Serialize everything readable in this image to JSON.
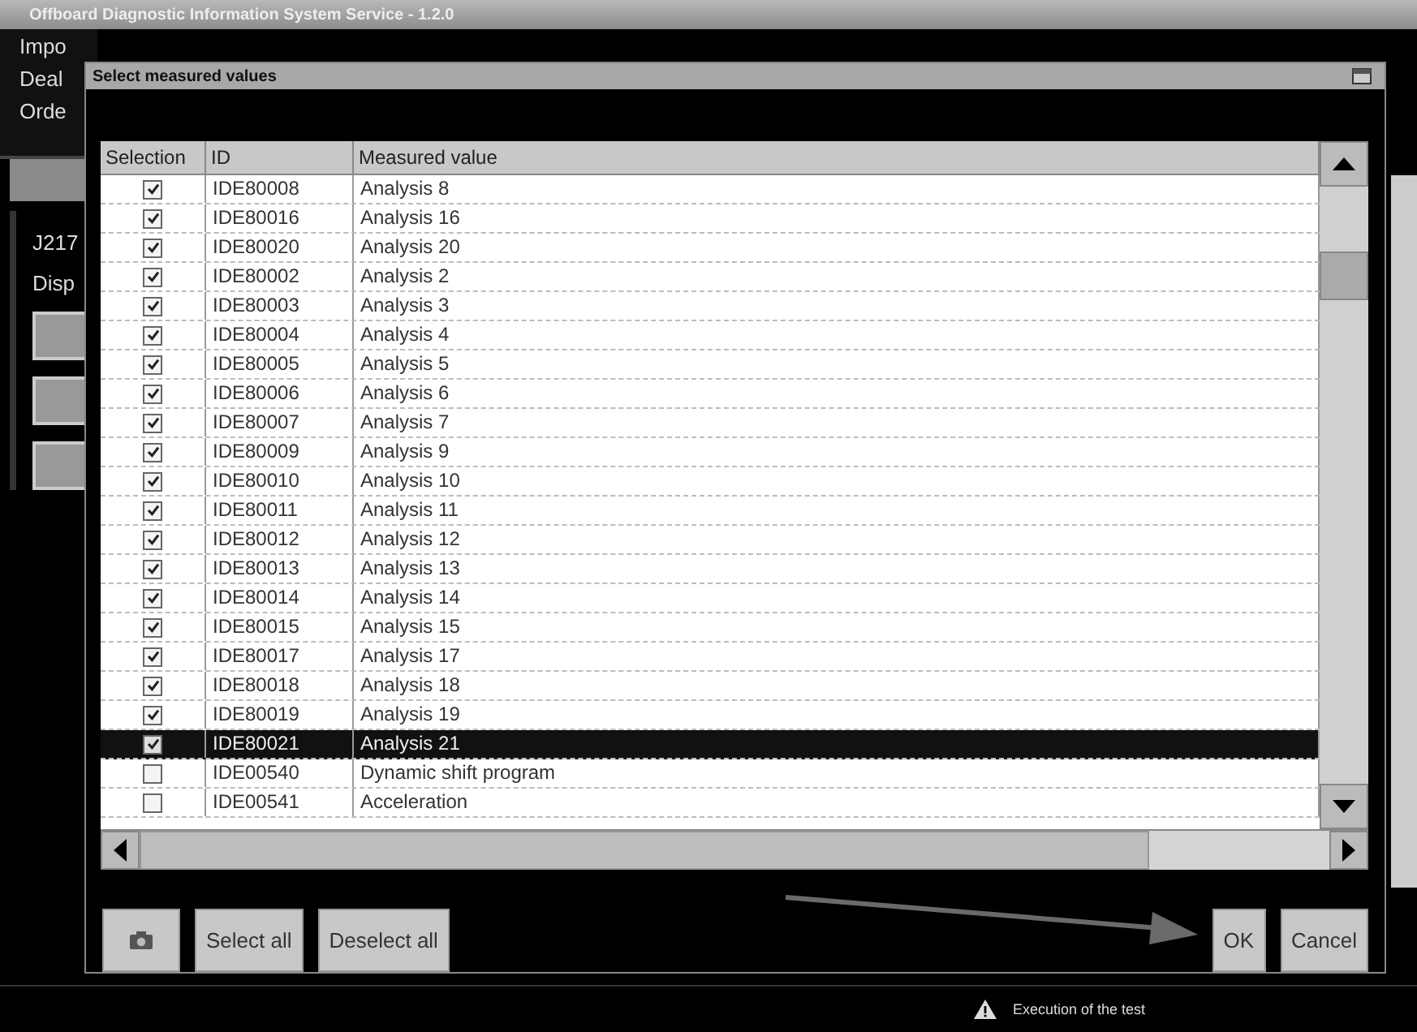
{
  "window": {
    "title": "Offboard Diagnostic Information System Service - 1.2.0"
  },
  "background": {
    "header_labels": [
      "Impo",
      "Deal",
      "Orde"
    ],
    "panel_labels": [
      "J217",
      "Disp"
    ]
  },
  "dialog": {
    "title": "Select measured values",
    "columns": [
      "Selection",
      "ID",
      "Measured value"
    ],
    "rows": [
      {
        "checked": true,
        "selected": false,
        "id": "IDE80008",
        "value": "Analysis 8"
      },
      {
        "checked": true,
        "selected": false,
        "id": "IDE80016",
        "value": "Analysis 16"
      },
      {
        "checked": true,
        "selected": false,
        "id": "IDE80020",
        "value": "Analysis 20"
      },
      {
        "checked": true,
        "selected": false,
        "id": "IDE80002",
        "value": "Analysis 2"
      },
      {
        "checked": true,
        "selected": false,
        "id": "IDE80003",
        "value": "Analysis 3"
      },
      {
        "checked": true,
        "selected": false,
        "id": "IDE80004",
        "value": "Analysis 4"
      },
      {
        "checked": true,
        "selected": false,
        "id": "IDE80005",
        "value": "Analysis 5"
      },
      {
        "checked": true,
        "selected": false,
        "id": "IDE80006",
        "value": "Analysis 6"
      },
      {
        "checked": true,
        "selected": false,
        "id": "IDE80007",
        "value": "Analysis 7"
      },
      {
        "checked": true,
        "selected": false,
        "id": "IDE80009",
        "value": "Analysis 9"
      },
      {
        "checked": true,
        "selected": false,
        "id": "IDE80010",
        "value": "Analysis 10"
      },
      {
        "checked": true,
        "selected": false,
        "id": "IDE80011",
        "value": "Analysis 11"
      },
      {
        "checked": true,
        "selected": false,
        "id": "IDE80012",
        "value": "Analysis 12"
      },
      {
        "checked": true,
        "selected": false,
        "id": "IDE80013",
        "value": "Analysis 13"
      },
      {
        "checked": true,
        "selected": false,
        "id": "IDE80014",
        "value": "Analysis 14"
      },
      {
        "checked": true,
        "selected": false,
        "id": "IDE80015",
        "value": "Analysis 15"
      },
      {
        "checked": true,
        "selected": false,
        "id": "IDE80017",
        "value": "Analysis 17"
      },
      {
        "checked": true,
        "selected": false,
        "id": "IDE80018",
        "value": "Analysis 18"
      },
      {
        "checked": true,
        "selected": false,
        "id": "IDE80019",
        "value": "Analysis 19"
      },
      {
        "checked": true,
        "selected": true,
        "id": "IDE80021",
        "value": "Analysis 21"
      },
      {
        "checked": false,
        "selected": false,
        "id": "IDE00540",
        "value": "Dynamic shift program"
      },
      {
        "checked": false,
        "selected": false,
        "id": "IDE00541",
        "value": "Acceleration"
      }
    ],
    "buttons": [
      {
        "kind": "icon"
      },
      {
        "kind": "text",
        "label": "Select all"
      },
      {
        "kind": "text",
        "label": "Deselect all"
      },
      {
        "kind": "spacer"
      },
      {
        "kind": "text",
        "label": "OK"
      },
      {
        "kind": "text",
        "label": "Cancel"
      }
    ]
  },
  "status_bar": {
    "message": "Execution of the test"
  }
}
